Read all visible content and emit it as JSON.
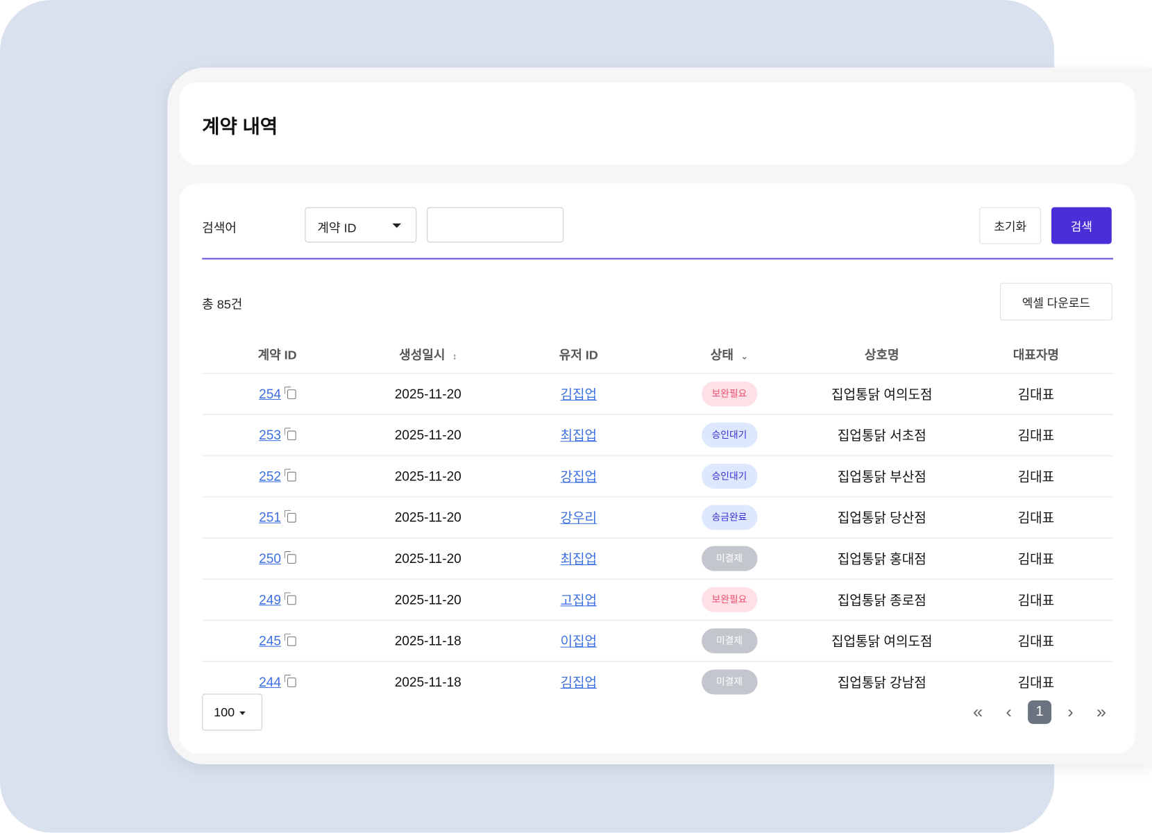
{
  "header": {
    "title": "계약 내역"
  },
  "search": {
    "label": "검색어",
    "field_select": "계약 ID",
    "input_value": "",
    "reset_label": "초기화",
    "search_label": "검색"
  },
  "summary": {
    "total": "총 85건",
    "excel_label": "엑셀 다운로드"
  },
  "table": {
    "columns": [
      "계약 ID",
      "생성일시",
      "유저 ID",
      "상태",
      "상호명",
      "대표자명"
    ],
    "rows": [
      {
        "id": "254",
        "date": "2025-11-20",
        "user": "김집업",
        "status": "보완필요",
        "status_type": "warn",
        "store": "집업통닭 여의도점",
        "rep": "김대표"
      },
      {
        "id": "253",
        "date": "2025-11-20",
        "user": "최집업",
        "status": "승인대기",
        "status_type": "info",
        "store": "집업통닭 서초점",
        "rep": "김대표"
      },
      {
        "id": "252",
        "date": "2025-11-20",
        "user": "강집업",
        "status": "승인대기",
        "status_type": "info",
        "store": "집업통닭 부산점",
        "rep": "김대표"
      },
      {
        "id": "251",
        "date": "2025-11-20",
        "user": "강우리",
        "status": "송금완료",
        "status_type": "info",
        "store": "집업통닭 당산점",
        "rep": "김대표"
      },
      {
        "id": "250",
        "date": "2025-11-20",
        "user": "최집업",
        "status": "미결제",
        "status_type": "muted",
        "store": "집업통닭 홍대점",
        "rep": "김대표"
      },
      {
        "id": "249",
        "date": "2025-11-20",
        "user": "고집업",
        "status": "보완필요",
        "status_type": "warn",
        "store": "집업통닭 종로점",
        "rep": "김대표"
      },
      {
        "id": "245",
        "date": "2025-11-18",
        "user": "이집업",
        "status": "미결제",
        "status_type": "muted",
        "store": "집업통닭 여의도점",
        "rep": "김대표"
      },
      {
        "id": "244",
        "date": "2025-11-18",
        "user": "김집업",
        "status": "미결제",
        "status_type": "muted",
        "store": "집업통닭 강남점",
        "rep": "김대표"
      }
    ]
  },
  "pagination": {
    "page_size": "100",
    "current_page": "1",
    "first": "«",
    "prev": "‹",
    "next": "›",
    "last": "»"
  },
  "colors": {
    "accent": "#4a2fd8",
    "warn_bg": "#ffe0e6",
    "warn_fg": "#f0506e",
    "info_bg": "#dde8ff",
    "info_fg": "#3a2fd0",
    "muted_bg": "#c3c6cc",
    "muted_fg": "#ffffff"
  }
}
